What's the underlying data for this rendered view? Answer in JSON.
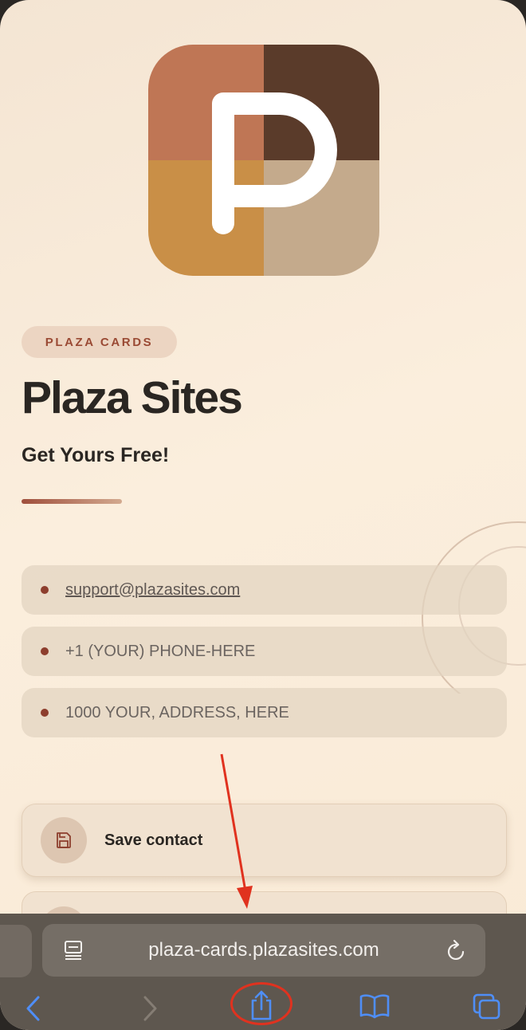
{
  "card": {
    "badge": "PLAZA CARDS",
    "title": "Plaza Sites",
    "subtitle": "Get Yours Free!",
    "contacts": [
      {
        "text": "support@plazasites.com",
        "type": "email"
      },
      {
        "text": "+1 (YOUR) PHONE-HERE",
        "type": "phone"
      },
      {
        "text": "1000 YOUR, ADDRESS, HERE",
        "type": "address"
      }
    ],
    "save_label": "Save contact"
  },
  "browser": {
    "url": "plaza-cards.plazasites.com",
    "icons": [
      "reader-icon",
      "reload-icon",
      "back-icon",
      "forward-icon",
      "share-icon",
      "bookmarks-icon",
      "tabs-icon"
    ]
  },
  "colors": {
    "accent": "#9a4a34",
    "logo_q1": "#bf7655",
    "logo_q2": "#5a3b2a",
    "logo_q3": "#c98f47",
    "logo_q4": "#c4aa8c",
    "annotation_red": "#e0321f",
    "safari_blue": "#4f8ef7"
  }
}
